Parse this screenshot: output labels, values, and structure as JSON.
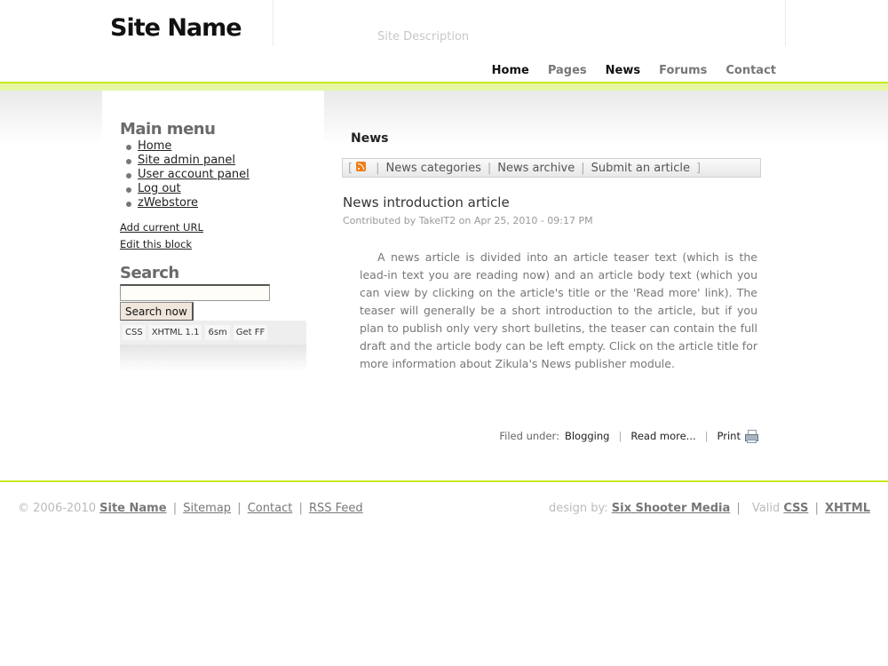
{
  "header": {
    "site_name": "Site Name",
    "site_description": "Site Description",
    "nav": [
      "Home",
      "Pages",
      "News",
      "Forums",
      "Contact"
    ],
    "active_nav": "Home",
    "accent_color": "#c6ea22"
  },
  "sidebar": {
    "menu_title": "Main menu",
    "menu_items": [
      "Home",
      "Site admin panel",
      "User account panel",
      "Log out",
      "zWebstore"
    ],
    "add_url": "Add current URL",
    "edit_block": "Edit this block",
    "search_title": "Search",
    "search_value": "",
    "search_button": "Search now",
    "badges": [
      "CSS",
      "XHTML 1.1",
      "6sm",
      "Get FF"
    ]
  },
  "main": {
    "page_title": "News",
    "subnav": {
      "open": "[",
      "close": "]",
      "rss_icon": "rss-icon",
      "links": [
        "News categories",
        "News archive",
        "Submit an article"
      ]
    },
    "article": {
      "title": "News introduction article",
      "meta": "Contributed by TakeIT2 on Apr 25, 2010 - 09:17 PM",
      "body": "A news article is divided into an article teaser text (which is the lead-in text you are reading now) and an article body text (which you can view by clicking on the article's title or the 'Read more' link). The teaser will generally be a short introduction to the article, but if you plan to publish only very short bulletins, the teaser can contain the full draft and the article body can be left empty. Click on the article title for more information about Zikula's News publisher module.",
      "filed_label": "Filed under:",
      "filed_value": "Blogging",
      "read_more": "Read more...",
      "print": "Print"
    }
  },
  "footer": {
    "copyright": "© 2006-2010",
    "site_name": "Site Name",
    "links": [
      "Sitemap",
      "Contact",
      "RSS Feed"
    ],
    "design_by": "design by:",
    "designer": "Six Shooter Media",
    "valid": "Valid",
    "valid_links": [
      "CSS",
      "XHTML"
    ]
  }
}
